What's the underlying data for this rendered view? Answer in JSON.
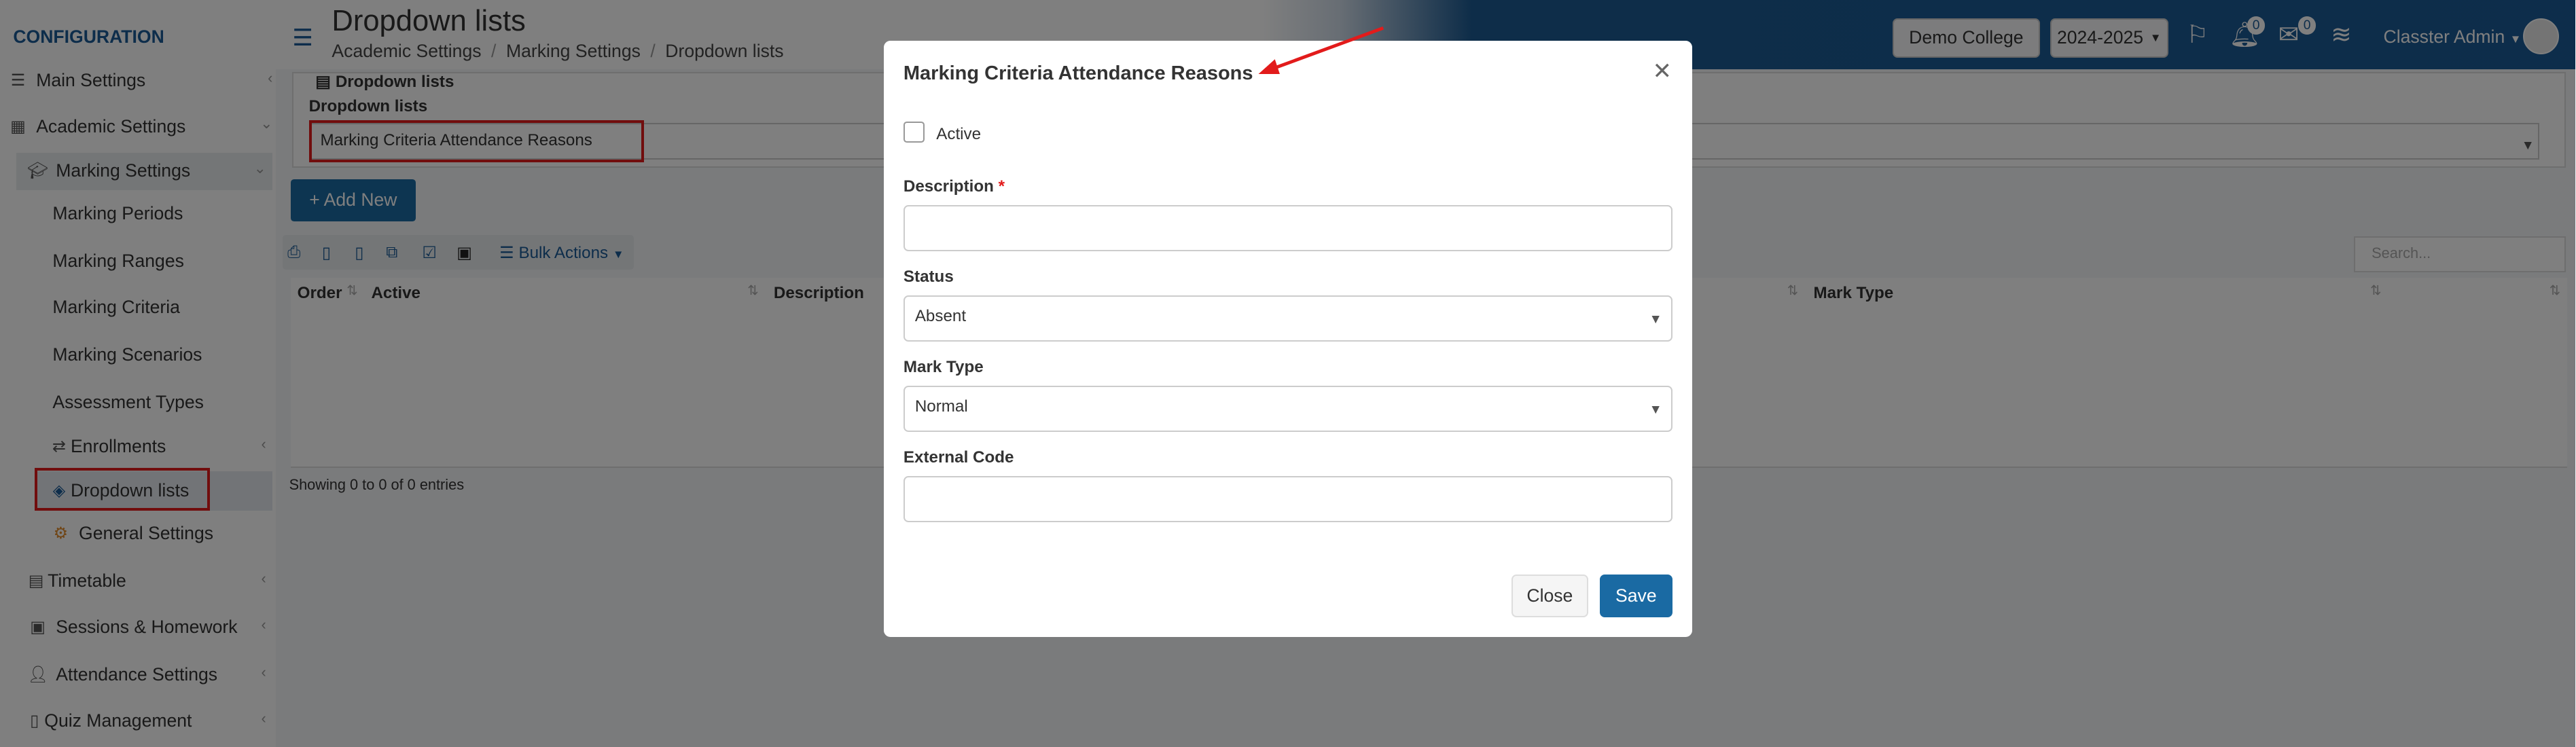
{
  "sidebar": {
    "section_title": "CONFIGURATION",
    "items": [
      {
        "label": "Main Settings",
        "icon": "sliders-icon"
      },
      {
        "label": "Academic Settings",
        "icon": "sitemap-icon"
      },
      {
        "label": "Marking Settings",
        "icon": "graduation-cap-icon"
      },
      {
        "label": "Marking Periods"
      },
      {
        "label": "Marking Ranges"
      },
      {
        "label": "Marking Criteria"
      },
      {
        "label": "Marking Scenarios"
      },
      {
        "label": "Assessment Types"
      },
      {
        "label": "Enrollments",
        "icon": "transfer-icon"
      },
      {
        "label": "Dropdown lists",
        "icon": "layers-icon"
      },
      {
        "label": "General Settings",
        "icon": "gear-icon"
      },
      {
        "label": "Timetable",
        "icon": "calendar-icon"
      },
      {
        "label": "Sessions & Homework",
        "icon": "chalkboard-icon"
      },
      {
        "label": "Attendance Settings",
        "icon": "user-check-icon"
      },
      {
        "label": "Quiz Management",
        "icon": "document-icon"
      }
    ]
  },
  "header": {
    "title": "Dropdown lists",
    "breadcrumb": [
      "Academic Settings",
      "Marking Settings",
      "Dropdown lists"
    ],
    "college_button": "Demo College",
    "year_select": "2024-2025",
    "notifications_count": "0",
    "messages_count": "0",
    "user_name": "Classter Admin"
  },
  "main": {
    "panel_heading": "Dropdown lists",
    "panel_label": "Dropdown lists",
    "selected_list": "Marking Criteria Attendance Reasons",
    "add_new_label": "+ Add New",
    "bulk_actions_label": "Bulk Actions",
    "search_placeholder": "Search...",
    "columns": [
      "Order",
      "Active",
      "Description",
      "Mark Type"
    ],
    "showing_text": "Showing 0 to 0 of 0 entries"
  },
  "modal": {
    "title": "Marking Criteria Attendance Reasons",
    "active_label": "Active",
    "active_checked": false,
    "description_label": "Description",
    "description_required_mark": "*",
    "description_value": "",
    "status_label": "Status",
    "status_value": "Absent",
    "mark_type_label": "Mark Type",
    "mark_type_value": "Normal",
    "external_code_label": "External Code",
    "external_code_value": "",
    "close_label": "Close",
    "save_label": "Save"
  },
  "colors": {
    "brand_blue": "#1a5a96",
    "button_blue": "#1a6aa3",
    "highlight_red": "#e21b1b"
  }
}
